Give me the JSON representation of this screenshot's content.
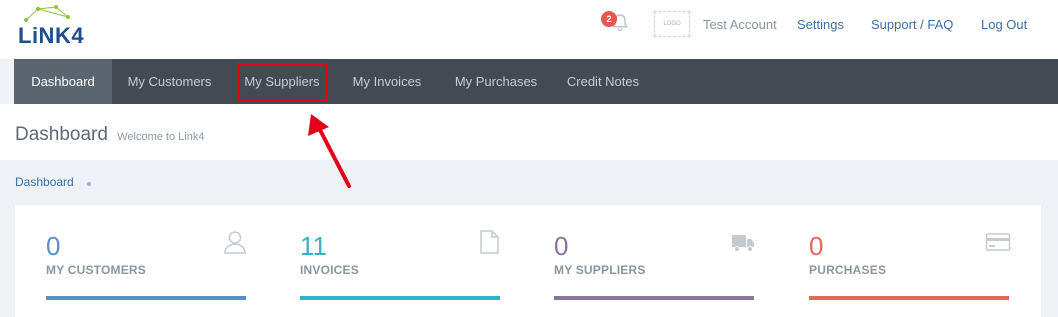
{
  "header": {
    "logo_text": "LiNK4",
    "notification_count": "2",
    "logo_placeholder": "LOGO",
    "account_name": "Test Account",
    "links": [
      "Settings",
      "Support / FAQ",
      "Log Out"
    ]
  },
  "nav": {
    "items": [
      "Dashboard",
      "My Customers",
      "My Suppliers",
      "My Invoices",
      "My Purchases",
      "Credit Notes"
    ],
    "active": "Dashboard",
    "highlighted": "My Suppliers"
  },
  "page": {
    "title": "Dashboard",
    "subtitle": "Welcome to Link4"
  },
  "breadcrumb": {
    "items": [
      "Dashboard"
    ]
  },
  "stats": [
    {
      "value": "0",
      "label": "MY CUSTOMERS",
      "color": "#5b8ec4",
      "icon": "user-icon"
    },
    {
      "value": "11",
      "label": "INVOICES",
      "color": "#33b4c2",
      "icon": "document-icon"
    },
    {
      "value": "0",
      "label": "MY SUPPLIERS",
      "color": "#8a739e",
      "icon": "truck-icon"
    },
    {
      "value": "0",
      "label": "PURCHASES",
      "color": "#e5675c",
      "icon": "credit-card-icon"
    }
  ],
  "colors": {
    "nav_bg": "#424a54",
    "nav_active_bg": "#5b6570",
    "highlight": "#e3001b",
    "link": "#3a6fa8"
  }
}
